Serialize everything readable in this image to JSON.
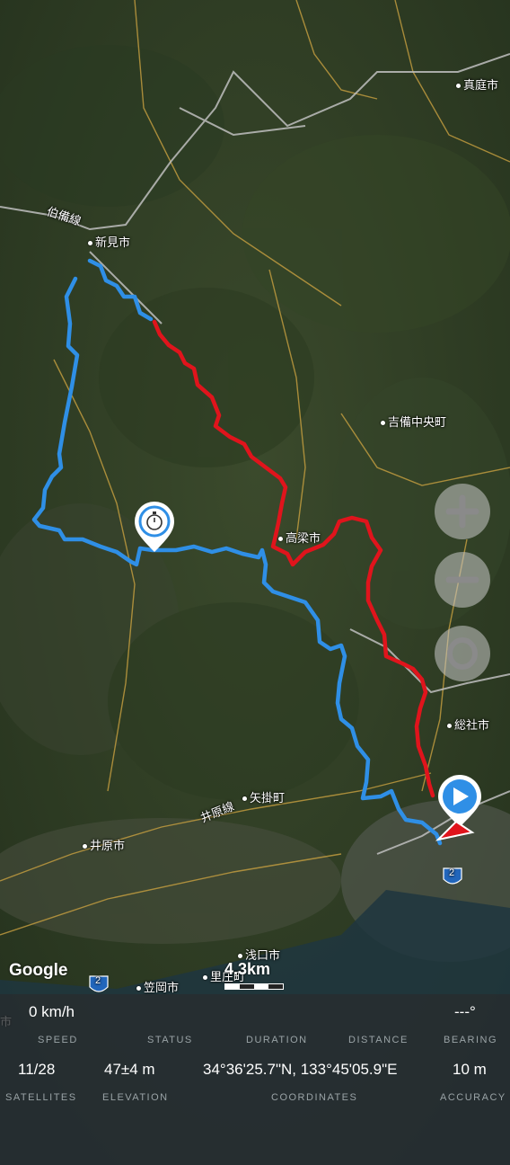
{
  "map": {
    "places": [
      {
        "name": "真庭市"
      },
      {
        "name": "伯備線"
      },
      {
        "name": "新見市"
      },
      {
        "name": "吉備中央町"
      },
      {
        "name": "高梁市"
      },
      {
        "name": "総社市"
      },
      {
        "name": "矢掛町"
      },
      {
        "name": "井原線"
      },
      {
        "name": "井原市"
      },
      {
        "name": "浅口市"
      },
      {
        "name": "笠岡市"
      },
      {
        "name": "里庄町"
      },
      {
        "name": "市"
      }
    ],
    "road_shield": "2",
    "road_shield_2": "2",
    "track_colors": {
      "blue": "#2f8fe6",
      "red": "#e0141c"
    },
    "attribution": "Google",
    "scale": "4.3km"
  },
  "controls": {
    "zoom_in": "+",
    "zoom_out": "−",
    "locate": "O"
  },
  "stats": {
    "speed": {
      "value": "0 km/h",
      "label": "SPEED"
    },
    "status": {
      "value": "",
      "label": "STATUS"
    },
    "duration": {
      "value": "",
      "label": "DURATION"
    },
    "distance": {
      "value": "",
      "label": "DISTANCE"
    },
    "bearing": {
      "value": "---°",
      "label": "BEARING"
    },
    "satellites": {
      "value": "11/28",
      "label": "SATELLITES"
    },
    "elevation": {
      "value": "47±4 m",
      "label": "ELEVATION"
    },
    "coordinates": {
      "value": "34°36'25.7\"N, 133°45'05.9\"E",
      "label": "COORDINATES"
    },
    "accuracy": {
      "value": "10 m",
      "label": "ACCURACY"
    }
  }
}
